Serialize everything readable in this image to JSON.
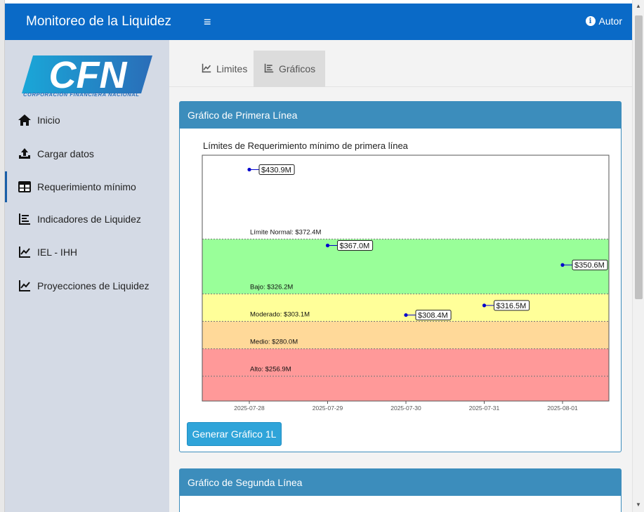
{
  "header": {
    "title": "Monitoreo de la Liquidez",
    "menu_icon": "hamburger-icon",
    "author_label": "Autor",
    "author_icon": "info-icon"
  },
  "logo": {
    "text": "CFN",
    "subtitle": "CORPORACIÓN FINANCIERA NACIONAL"
  },
  "sidebar": {
    "items": [
      {
        "label": "Inicio",
        "icon": "home-icon"
      },
      {
        "label": "Cargar datos",
        "icon": "upload-icon"
      },
      {
        "label": "Requerimiento mínimo",
        "icon": "table-icon",
        "active": true
      },
      {
        "label": "Indicadores de Liquidez",
        "icon": "list-icon"
      },
      {
        "label": "IEL - IHH",
        "icon": "line-chart-icon"
      },
      {
        "label": "Proyecciones de Liquidez",
        "icon": "line-chart-icon"
      }
    ]
  },
  "tabs": [
    {
      "label": "Limites",
      "icon": "line-chart-icon"
    },
    {
      "label": "Gráficos",
      "icon": "list-icon",
      "active": true
    }
  ],
  "card1": {
    "title": "Gráfico de Primera Línea",
    "button_label": "Generar Gráfico 1L"
  },
  "card2": {
    "title": "Gráfico de Segunda Línea"
  },
  "colors": {
    "header": "#0a6ac7",
    "card_header": "#3c8dbc",
    "button": "#2fa4d9",
    "sidebar": "#d4dae5",
    "band_normal": "#99ff99",
    "band_bajo": "#ffff99",
    "band_moderado": "#ffd999",
    "band_alto": "#ff9999",
    "point": "#0000cc"
  },
  "chart_data": {
    "type": "scatter",
    "title": "Límites de Requerimiento mínimo de primera línea",
    "xlabel": "",
    "ylabel": "",
    "x": [
      "2025-07-28",
      "2025-07-29",
      "2025-07-30",
      "2025-07-31",
      "2025-08-01"
    ],
    "values": [
      430.9,
      367.0,
      308.4,
      316.5,
      350.6
    ],
    "point_labels": [
      "$430.9M",
      "$367.0M",
      "$308.4M",
      "$316.5M",
      "$350.6M"
    ],
    "ylim": [
      236.0,
      443.0
    ],
    "grid": false,
    "thresholds": [
      {
        "label": "Límite Normal: $372.4M",
        "value": 372.4
      },
      {
        "label": "Bajo: $326.2M",
        "value": 326.2
      },
      {
        "label": "Moderado: $303.1M",
        "value": 303.1
      },
      {
        "label": "Medio: $280.0M",
        "value": 280.0
      },
      {
        "label": "Alto: $256.9M",
        "value": 256.9
      }
    ]
  }
}
